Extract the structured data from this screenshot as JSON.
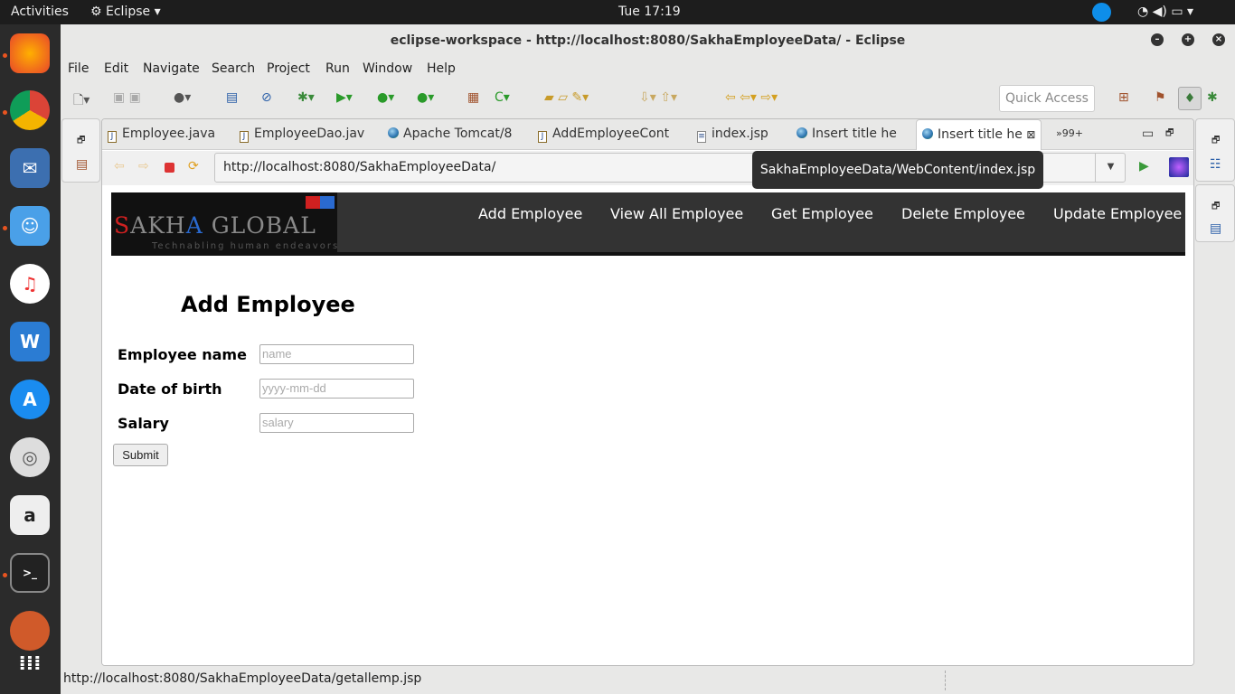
{
  "topbar": {
    "activities": "Activities",
    "app": "Eclipse",
    "clock": "Tue 17:19"
  },
  "window": {
    "title": "eclipse-workspace - http://localhost:8080/SakhaEmployeeData/ - Eclipse"
  },
  "menu": [
    "File",
    "Edit",
    "Navigate",
    "Search",
    "Project",
    "Run",
    "Window",
    "Help"
  ],
  "toolbar": {
    "quick_access": "Quick Access"
  },
  "tabs": [
    {
      "label": "Employee.java",
      "icon": "java-file-icon"
    },
    {
      "label": "EmployeeDao.jav",
      "icon": "java-file-icon"
    },
    {
      "label": "Apache Tomcat/8",
      "icon": "globe-icon"
    },
    {
      "label": "AddEmployeeCont",
      "icon": "java-file-icon"
    },
    {
      "label": "index.jsp",
      "icon": "jsp-file-icon"
    },
    {
      "label": "Insert title he",
      "icon": "globe-icon"
    },
    {
      "label": "Insert title he",
      "icon": "globe-icon",
      "active": true
    }
  ],
  "tabs_overflow": "99+",
  "browser": {
    "url": "http://localhost:8080/SakhaEmployeeData/",
    "tooltip": "SakhaEmployeeData/WebContent/index.jsp"
  },
  "page": {
    "logo": {
      "text": "SAKHA GLOBAL",
      "tagline": "Technabling human endeavors"
    },
    "nav": [
      "Add Employee",
      "View All Employee",
      "Get Employee",
      "Delete Employee",
      "Update Employee"
    ],
    "heading": "Add Employee",
    "fields": [
      {
        "label": "Employee name",
        "placeholder": "name"
      },
      {
        "label": "Date of birth",
        "placeholder": "yyyy-mm-dd"
      },
      {
        "label": "Salary",
        "placeholder": "salary"
      }
    ],
    "submit": "Submit"
  },
  "status": "http://localhost:8080/SakhaEmployeeData/getallemp.jsp"
}
